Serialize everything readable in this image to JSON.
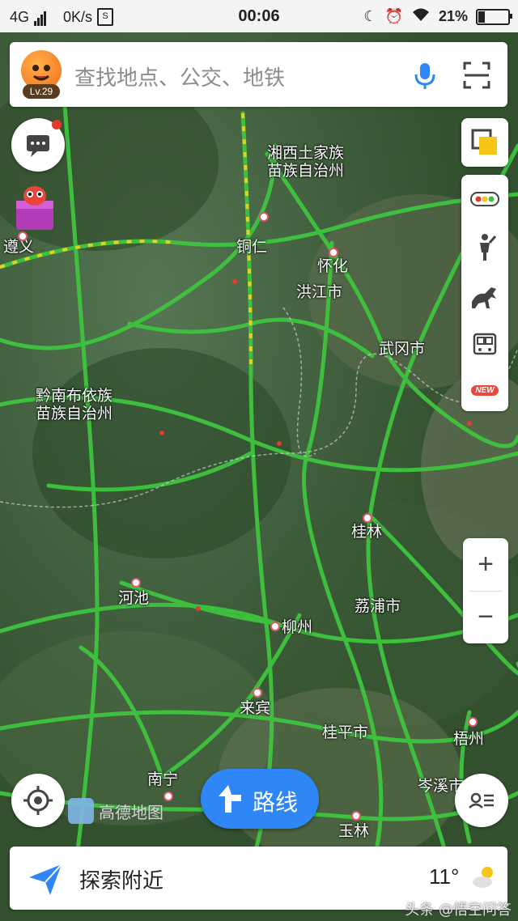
{
  "status_bar": {
    "network": "4G",
    "speed": "0K/s",
    "time": "00:06",
    "battery": "21%"
  },
  "search": {
    "placeholder": "查找地点、公交、地铁",
    "level": "Lv.29"
  },
  "map": {
    "cities": [
      {
        "name": "湘西土家族\n苗族自治州",
        "key": "xiangxi"
      },
      {
        "name": "铜仁",
        "key": "tongren"
      },
      {
        "name": "遵义",
        "key": "zunyi"
      },
      {
        "name": "怀化",
        "key": "huaihua"
      },
      {
        "name": "洪江市",
        "key": "hongjiang"
      },
      {
        "name": "武冈市",
        "key": "wugang"
      },
      {
        "name": "黔南布依族\n苗族自治州",
        "key": "qiannan"
      },
      {
        "name": "桂林",
        "key": "guilin"
      },
      {
        "name": "河池",
        "key": "hechi"
      },
      {
        "name": "荔浦市",
        "key": "lipu"
      },
      {
        "name": "柳州",
        "key": "liuzhou"
      },
      {
        "name": "来宾",
        "key": "laibin"
      },
      {
        "name": "桂平市",
        "key": "guiping"
      },
      {
        "name": "梧州",
        "key": "wuzhou"
      },
      {
        "name": "南宁",
        "key": "nanning"
      },
      {
        "name": "岑溪市",
        "key": "cenxi"
      },
      {
        "name": "玉林",
        "key": "yulin"
      }
    ],
    "watermark": "高德地图"
  },
  "controls": {
    "route_label": "路线",
    "zoom_in": "+",
    "zoom_out": "−",
    "new_badge": "NEW"
  },
  "bottom": {
    "explore_label": "探索附近",
    "temperature": "11°"
  },
  "credit": "头条 @悟空问答",
  "colors": {
    "accent": "#2f86f6",
    "traffic_smooth": "#3ec43e",
    "traffic_slow": "#f5d21c",
    "traffic_jam": "#e33b2b"
  },
  "icons": [
    "message-icon",
    "gift-mascot-icon",
    "microphone-icon",
    "scan-icon",
    "layers-icon",
    "traffic-icon",
    "person-icon",
    "horse-icon",
    "bus-icon",
    "locate-icon",
    "send-arrow-icon",
    "weather-icon",
    "list-icon"
  ]
}
